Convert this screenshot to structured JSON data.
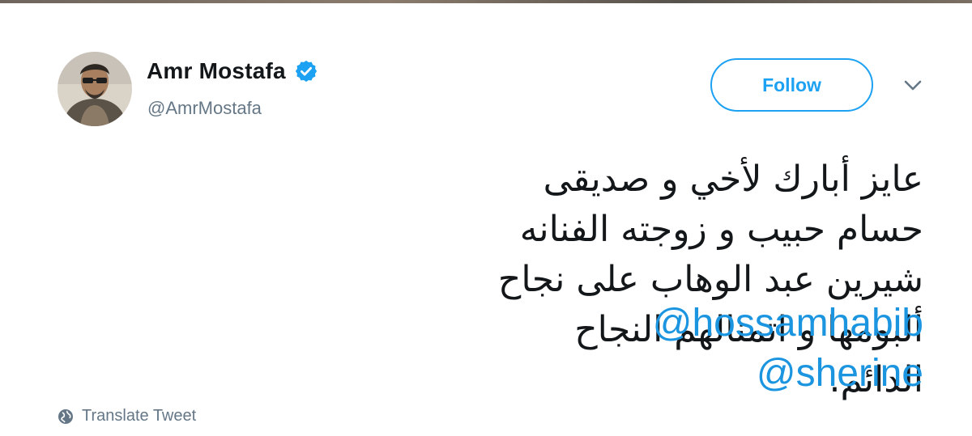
{
  "tweet": {
    "author": {
      "display_name": "Amr Mostafa",
      "handle": "@AmrMostafa",
      "verified": true
    },
    "follow_label": "Follow",
    "text": "عايز أبارك لأخي و صديقى حسام حبيب و زوجته الفنانه شيرين عبد الوهاب على نجاح ألبومها و اتمنالهم النجاح الدائم.",
    "mentions": [
      "@hossamhabib",
      "@sherine"
    ],
    "translate_label": "Translate Tweet"
  },
  "icons": {
    "avatar": "avatar",
    "verified": "verified-badge-icon",
    "caret": "chevron-down-icon",
    "translate": "globe-icon"
  },
  "colors": {
    "accent": "#1da1f2",
    "mention": "#1b95e0",
    "secondary_text": "#657786",
    "primary_text": "#14171a"
  }
}
